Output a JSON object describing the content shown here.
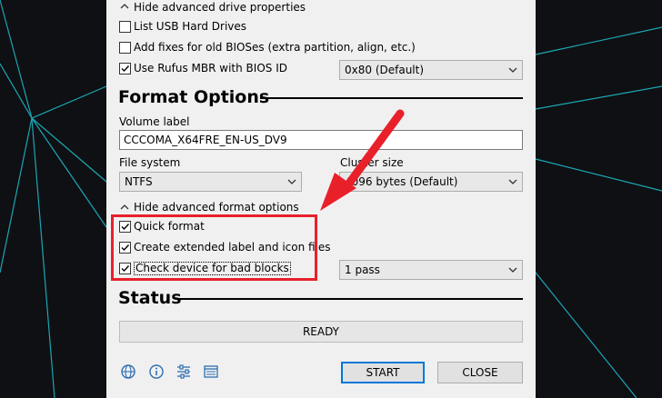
{
  "drive_properties": {
    "toggle_label": "Hide advanced drive properties",
    "list_usb": {
      "label": "List USB Hard Drives",
      "checked": false
    },
    "old_bios_fixes": {
      "label": "Add fixes for old BIOSes (extra partition, align, etc.)",
      "checked": false
    },
    "rufus_mbr": {
      "label": "Use Rufus MBR with BIOS ID",
      "checked": true
    },
    "bios_id_value": "0x80 (Default)"
  },
  "format_options": {
    "title": "Format Options",
    "volume_label_caption": "Volume label",
    "volume_label_value": "CCCOMA_X64FRE_EN-US_DV9",
    "file_system_caption": "File system",
    "file_system_value": "NTFS",
    "cluster_size_caption": "Cluster size",
    "cluster_size_value": "4096 bytes (Default)",
    "toggle_label": "Hide advanced format options",
    "quick_format": {
      "label": "Quick format",
      "checked": true
    },
    "extended_label": {
      "label": "Create extended label and icon files",
      "checked": true
    },
    "bad_blocks": {
      "label": "Check device for bad blocks",
      "checked": true
    },
    "passes_value": "1 pass"
  },
  "status": {
    "title": "Status",
    "text": "READY"
  },
  "footer": {
    "start_label": "START",
    "close_label": "CLOSE",
    "icons": [
      "globe-icon",
      "info-icon",
      "settings-icon",
      "log-icon"
    ]
  },
  "colors": {
    "highlight": "#e8202a",
    "accent": "#0078d7",
    "background_lines": "#1fb6c6"
  }
}
